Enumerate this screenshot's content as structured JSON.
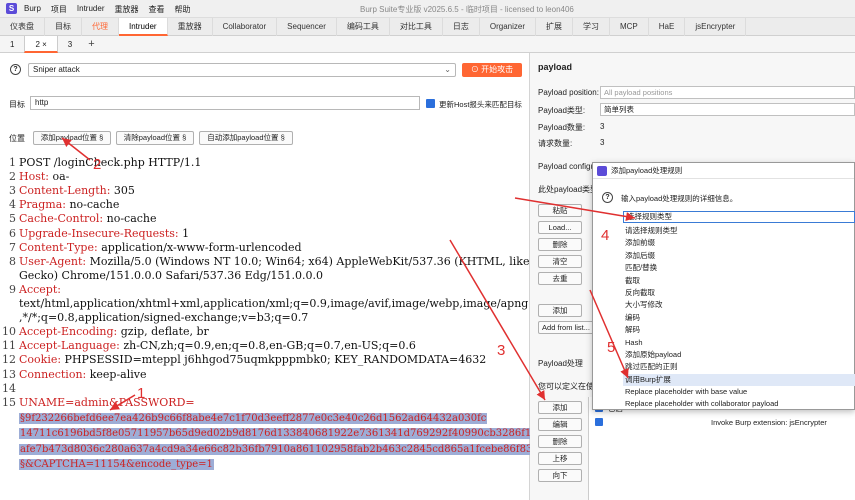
{
  "window": {
    "title": "Burp Suite专业版  v2025.6.5 - 临时项目 - licensed to leon406",
    "menu": [
      "Burp",
      "项目",
      "Intruder",
      "重放器",
      "查看",
      "帮助"
    ]
  },
  "tabs": [
    "仪表盘",
    "目标",
    "代理",
    "Intruder",
    "重放器",
    "Collaborator",
    "Sequencer",
    "编码工具",
    "对比工具",
    "日志",
    "Organizer",
    "扩展",
    "学习",
    "MCP",
    "HaE",
    "jsEncrypter"
  ],
  "subtabs": [
    "1",
    "2 ×",
    "3"
  ],
  "subtab_add": "+",
  "attack": {
    "type": "Sniper attack",
    "start_label": "⊙ 开始攻击"
  },
  "target": {
    "label": "目标",
    "value": "http",
    "host_update_label": "更新Host报头来匹配目标"
  },
  "positions": {
    "label": "位置",
    "add_label": "添加payload位置 §",
    "clear_label": "清除payload位置 §",
    "auto_label": "自动添加payload位置 §"
  },
  "request_lines": [
    {
      "n": "1",
      "text": "POST /loginCheck.php HTTP/1.1"
    },
    {
      "n": "2",
      "key": "Host:",
      "val": " oa-"
    },
    {
      "n": "3",
      "key": "Content-Length:",
      "val": " 305"
    },
    {
      "n": "4",
      "key": "Pragma:",
      "val": " no-cache"
    },
    {
      "n": "5",
      "key": "Cache-Control:",
      "val": " no-cache"
    },
    {
      "n": "6",
      "key": "Upgrade-Insecure-Requests:",
      "val": " 1"
    },
    {
      "n": "7",
      "key": "Content-Type:",
      "val": " application/x-www-form-urlencoded"
    },
    {
      "n": "8",
      "key": "User-Agent:",
      "val": " Mozilla/5.0 (Windows NT 10.0; Win64; x64) AppleWebKit/537.36 (KHTML, like"
    },
    {
      "n": "",
      "text": "Gecko) Chrome/151.0.0.0 Safari/537.36 Edg/151.0.0.0"
    },
    {
      "n": "9",
      "key": "Accept:",
      "val": ""
    },
    {
      "n": "",
      "text": "text/html,application/xhtml+xml,application/xml;q=0.9,image/avif,image/webp,image/apng"
    },
    {
      "n": "",
      "text": ",*/*;q=0.8,application/signed-exchange;v=b3;q=0.7"
    },
    {
      "n": "10",
      "key": "Accept-Encoding:",
      "val": " gzip, deflate, br"
    },
    {
      "n": "11",
      "key": "Accept-Language:",
      "val": " zh-CN,zh;q=0.9,en;q=0.8,en-GB;q=0.7,en-US;q=0.6"
    },
    {
      "n": "12",
      "key": "Cookie:",
      "val": " PHPSESSID=mteppl j6hhgod75uqmkpppmbk0; KEY_RANDOMDATA=4632"
    },
    {
      "n": "13",
      "key": "Connection:",
      "val": " keep-alive"
    },
    {
      "n": "14",
      "text": ""
    },
    {
      "n": "15",
      "text": "UNAME=admin&PASSWORD="
    }
  ],
  "payload_lines": [
    "§9f232266befd6ee7ea426b9c66f8abe4e7c1f70d3eeff2877e0c3e40c26d1562ad64432a030fc",
    "14711c6196bd5f8e05711957b65d9ed02b9d8176d133840681922e7361341d769292f40990cb3286f1dbfc",
    "afe7b473d8036c280a637a4cd9a34e66c82b36fb7910a861102958fab2b463c2845cd865a1fcebe86f83c4",
    "§&CAPTCHA=11154&encode_type=1"
  ],
  "right": {
    "title": "payload",
    "position_label": "Payload position:",
    "position_value": "All payload positions",
    "type_label": "Payload类型:",
    "type_value": "简单列表",
    "count_label": "Payload数量:",
    "count_value": "3",
    "requests_label": "请求数量:",
    "requests_value": "3",
    "config_label": "Payload configu",
    "config_desc": "此处payload类型",
    "side_buttons": [
      "粘贴",
      "Load...",
      "删除",
      "清空",
      "去重"
    ],
    "add_button": "添加",
    "add_from_list": "Add from list...",
    "processing_label": "Payload处理",
    "processing_desc": "您可以定义在使用payload",
    "rule_buttons": [
      "添加",
      "编辑",
      "删除",
      "上移",
      "向下"
    ],
    "rule_enabled_header": "已启",
    "rule_item": "Invoke Burp extension: jsEncrypter"
  },
  "dialog": {
    "title": "添加payload处理规则",
    "prompt": "输入payload处理规则的详细信息。",
    "select_placeholder": "选择规则类型",
    "options": [
      "请选择规则类型",
      "添加前缀",
      "添加后缀",
      "匹配/替换",
      "截取",
      "反向截取",
      "大小写修改",
      "编码",
      "解码",
      "Hash",
      "添加原始payload",
      "跳过匹配的正则",
      "调用Burp扩展",
      "Replace placeholder with base value",
      "Replace placeholder with collaborator payload"
    ],
    "highlighted_index": 12
  },
  "annotations": [
    "1",
    "2",
    "3",
    "4",
    "5"
  ],
  "colors": {
    "accent": "#ff6633",
    "annotation": "#e03030",
    "selection": "#9dadd6",
    "checkbox": "#2b6fdc"
  }
}
